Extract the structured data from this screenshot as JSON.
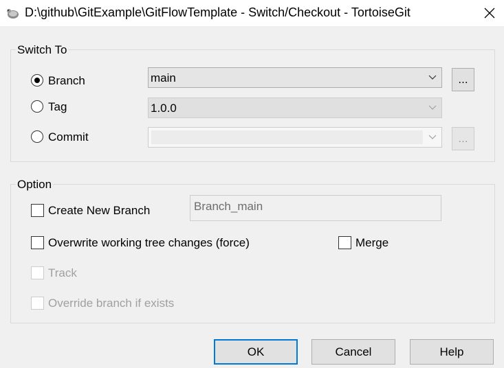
{
  "window": {
    "title": "D:\\github\\GitExample\\GitFlowTemplate - Switch/Checkout - TortoiseGit",
    "icon": "tortoisegit-icon",
    "close_icon": "close-icon"
  },
  "switch_to": {
    "label": "Switch To",
    "options": [
      {
        "label": "Branch",
        "selected": true
      },
      {
        "label": "Tag",
        "selected": false
      },
      {
        "label": "Commit",
        "selected": false
      }
    ],
    "branch_value": "main",
    "tag_value": "1.0.0",
    "commit_value": "",
    "browse_label": "..."
  },
  "option": {
    "label": "Option",
    "create_new_branch": {
      "label": "Create New Branch",
      "checked": false
    },
    "new_branch_name": "Branch_main",
    "overwrite": {
      "label": "Overwrite working tree changes (force)",
      "checked": false
    },
    "merge": {
      "label": "Merge",
      "checked": false
    },
    "track": {
      "label": "Track",
      "checked": false,
      "enabled": false
    },
    "override": {
      "label": "Override branch if exists",
      "checked": false,
      "enabled": false
    }
  },
  "buttons": {
    "ok": "OK",
    "cancel": "Cancel",
    "help": "Help"
  },
  "colors": {
    "accent": "#0078d7",
    "background": "#f0f0f0"
  }
}
